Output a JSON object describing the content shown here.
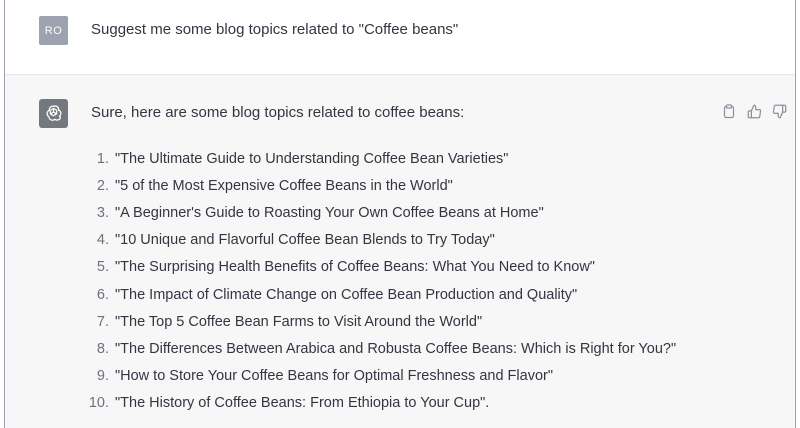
{
  "user": {
    "avatar_initials": "RO",
    "message": "Suggest me some blog topics related to \"Coffee beans\""
  },
  "assistant": {
    "avatar_icon": "openai-logo-icon",
    "intro": "Sure, here are some blog topics related to coffee beans:",
    "actions": [
      {
        "name": "copy-icon"
      },
      {
        "name": "thumbs-up-icon"
      },
      {
        "name": "thumbs-down-icon"
      }
    ],
    "topics": [
      {
        "num": "1.",
        "text": "\"The Ultimate Guide to Understanding Coffee Bean Varieties\""
      },
      {
        "num": "2.",
        "text": "\"5 of the Most Expensive Coffee Beans in the World\""
      },
      {
        "num": "3.",
        "text": "\"A Beginner's Guide to Roasting Your Own Coffee Beans at Home\""
      },
      {
        "num": "4.",
        "text": "\"10 Unique and Flavorful Coffee Bean Blends to Try Today\""
      },
      {
        "num": "5.",
        "text": "\"The Surprising Health Benefits of Coffee Beans: What You Need to Know\""
      },
      {
        "num": "6.",
        "text": "\"The Impact of Climate Change on Coffee Bean Production and Quality\""
      },
      {
        "num": "7.",
        "text": "\"The Top 5 Coffee Bean Farms to Visit Around the World\""
      },
      {
        "num": "8.",
        "text": "\"The Differences Between Arabica and Robusta Coffee Beans: Which is Right for You?\""
      },
      {
        "num": "9.",
        "text": "\"How to Store Your Coffee Beans for Optimal Freshness and Flavor\""
      },
      {
        "num": "10.",
        "text": "\"The History of Coffee Beans: From Ethiopia to Your Cup\"."
      }
    ]
  },
  "colors": {
    "user_bg": "#ffffff",
    "assistant_bg": "#f7f7f8",
    "user_avatar_bg": "#9ca3af",
    "bot_avatar_bg": "#74797f",
    "text": "#343541"
  }
}
